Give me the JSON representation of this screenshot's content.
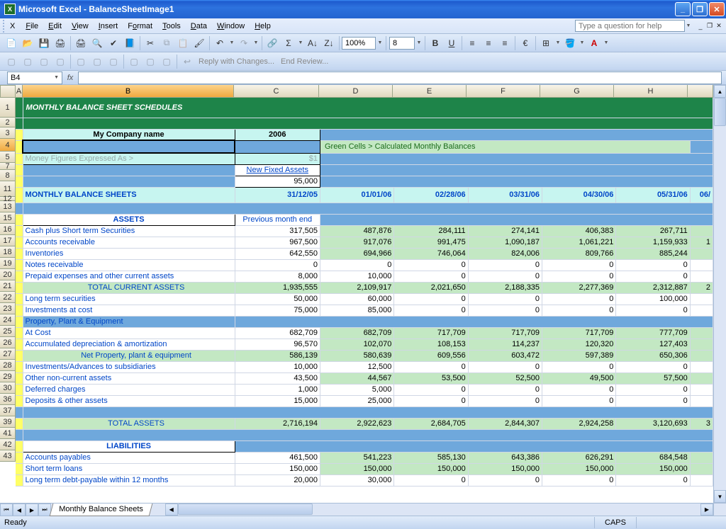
{
  "window": {
    "title": "Microsoft Excel - BalanceSheetImage1"
  },
  "menus": [
    "File",
    "Edit",
    "View",
    "Insert",
    "Format",
    "Tools",
    "Data",
    "Window",
    "Help"
  ],
  "help_placeholder": "Type a question for help",
  "toolbar": {
    "zoom": "100%",
    "font_size": "8",
    "reply": "Reply with Changes...",
    "end_review": "End Review..."
  },
  "namebox": "B4",
  "columns": [
    "A",
    "B",
    "C",
    "D",
    "E",
    "F",
    "G",
    "H"
  ],
  "col_widths": {
    "A": 10,
    "B": 298,
    "C": 120,
    "rest": 104,
    "I": 32
  },
  "rows_visible": [
    "1",
    "2",
    "3",
    "4",
    "5",
    "7",
    "8",
    "11",
    "12",
    "13",
    "15",
    "16",
    "17",
    "18",
    "19",
    "20",
    "21",
    "22",
    "23",
    "24",
    "25",
    "26",
    "27",
    "28",
    "29",
    "30",
    "36",
    "37",
    "39",
    "41",
    "42",
    "43"
  ],
  "sheet": {
    "title": "MONTHLY BALANCE SHEET SCHEDULES",
    "company": "My Company name",
    "year": "2006",
    "callout": "Green Cells > Calculated Monthly Balances",
    "money_note": "Money Figures Expressed As >",
    "money_val": "$1",
    "new_fixed_assets": "New Fixed Assets",
    "new_fixed_assets_val": "95,000",
    "monthly_label": "MONTHLY BALANCE SHEETS",
    "dates": [
      "31/12/05",
      "01/01/06",
      "02/28/06",
      "03/31/06",
      "04/30/06",
      "05/31/06",
      "06/"
    ],
    "assets_hdr": "ASSETS",
    "prev_month": "Previous month end",
    "liabilities_hdr": "LIABILITIES",
    "rows": {
      "cash": {
        "label": "Cash plus Short term Securities",
        "v": [
          "317,505",
          "487,876",
          "284,111",
          "274,141",
          "406,383",
          "267,711",
          ""
        ]
      },
      "ar": {
        "label": "Accounts receivable",
        "v": [
          "967,500",
          "917,076",
          "991,475",
          "1,090,187",
          "1,061,221",
          "1,159,933",
          "1"
        ]
      },
      "inv": {
        "label": "Inventories",
        "v": [
          "642,550",
          "694,966",
          "746,064",
          "824,006",
          "809,766",
          "885,244",
          ""
        ]
      },
      "notes": {
        "label": "Notes receivable",
        "v": [
          "0",
          "0",
          "0",
          "0",
          "0",
          "0",
          ""
        ]
      },
      "prepaid": {
        "label": "Prepaid expenses and other current assets",
        "v": [
          "8,000",
          "10,000",
          "0",
          "0",
          "0",
          "0",
          ""
        ]
      },
      "tca": {
        "label": "TOTAL CURRENT ASSETS",
        "v": [
          "1,935,555",
          "2,109,917",
          "2,021,650",
          "2,188,335",
          "2,277,369",
          "2,312,887",
          "2"
        ]
      },
      "lts": {
        "label": "Long term securities",
        "v": [
          "50,000",
          "60,000",
          "0",
          "0",
          "0",
          "100,000",
          ""
        ]
      },
      "invc": {
        "label": "Investments at cost",
        "v": [
          "75,000",
          "85,000",
          "0",
          "0",
          "0",
          "0",
          ""
        ]
      },
      "ppe": {
        "label": "Property, Plant & Equipment",
        "v": [
          "",
          "",
          "",
          "",
          "",
          "",
          ""
        ]
      },
      "atcost": {
        "label": "At Cost",
        "v": [
          "682,709",
          "682,709",
          "717,709",
          "717,709",
          "717,709",
          "777,709",
          ""
        ]
      },
      "accdep": {
        "label": "Accumulated depreciation & amortization",
        "v": [
          "96,570",
          "102,070",
          "108,153",
          "114,237",
          "120,320",
          "127,403",
          ""
        ]
      },
      "netppe": {
        "label": "Net Property, plant & equipment",
        "v": [
          "586,139",
          "580,639",
          "609,556",
          "603,472",
          "597,389",
          "650,306",
          ""
        ]
      },
      "invadv": {
        "label": "Investments/Advances to subsidiaries",
        "v": [
          "10,000",
          "12,500",
          "0",
          "0",
          "0",
          "0",
          ""
        ]
      },
      "onc": {
        "label": "Other non-current assets",
        "v": [
          "43,500",
          "44,567",
          "53,500",
          "52,500",
          "49,500",
          "57,500",
          ""
        ]
      },
      "defc": {
        "label": "Deferred charges",
        "v": [
          "1,000",
          "5,000",
          "0",
          "0",
          "0",
          "0",
          ""
        ]
      },
      "dep": {
        "label": "Deposits & other assets",
        "v": [
          "15,000",
          "25,000",
          "0",
          "0",
          "0",
          "0",
          ""
        ]
      },
      "ta": {
        "label": "TOTAL ASSETS",
        "v": [
          "2,716,194",
          "2,922,623",
          "2,684,705",
          "2,844,307",
          "2,924,258",
          "3,120,693",
          "3"
        ]
      },
      "ap": {
        "label": "Accounts payables",
        "v": [
          "461,500",
          "541,223",
          "585,130",
          "643,386",
          "626,291",
          "684,548",
          ""
        ]
      },
      "stl": {
        "label": "Short term loans",
        "v": [
          "150,000",
          "150,000",
          "150,000",
          "150,000",
          "150,000",
          "150,000",
          ""
        ]
      },
      "ltd": {
        "label": "Long term debt-payable within 12 months",
        "v": [
          "20,000",
          "30,000",
          "0",
          "0",
          "0",
          "0",
          ""
        ]
      }
    }
  },
  "tab_name": "Monthly Balance Sheets",
  "status": {
    "ready": "Ready",
    "caps": "CAPS"
  }
}
